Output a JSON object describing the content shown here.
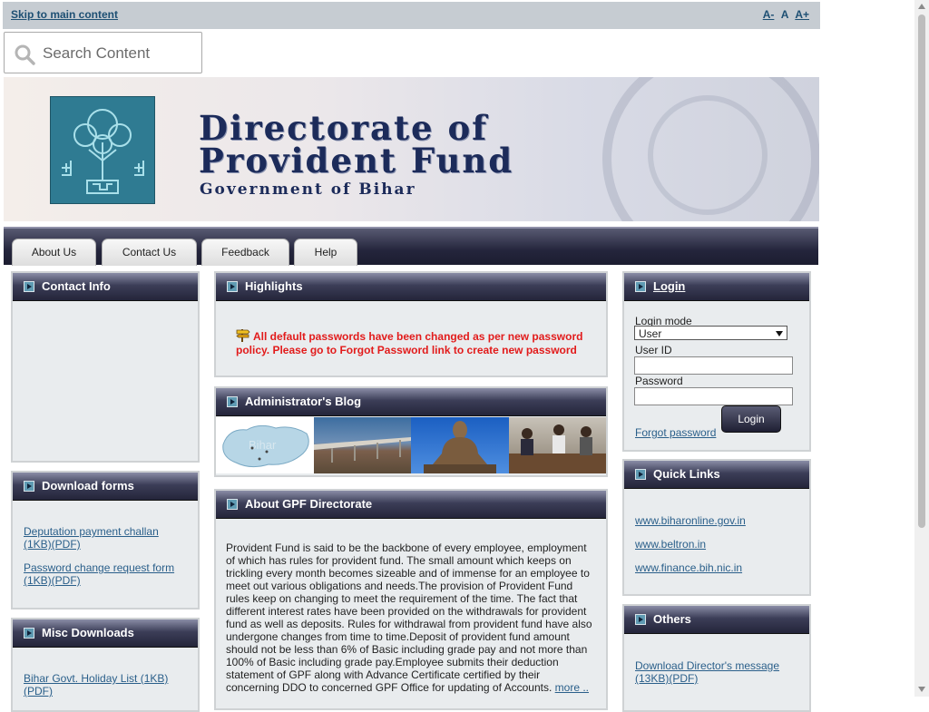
{
  "topbar": {
    "skip_link": "Skip to main content",
    "font_smaller": "A-",
    "font_normal": "A",
    "font_larger": "A+"
  },
  "search": {
    "placeholder": "Search Content"
  },
  "banner": {
    "title_line1": "Directorate of",
    "title_line2": "Provident Fund",
    "subtitle": "Government of Bihar"
  },
  "nav": {
    "tabs": [
      {
        "label": "About Us"
      },
      {
        "label": "Contact Us"
      },
      {
        "label": "Feedback"
      },
      {
        "label": "Help"
      }
    ]
  },
  "contact_info": {
    "title": "Contact Info"
  },
  "download_forms": {
    "title": "Download forms",
    "links": [
      {
        "label": "Deputation payment challan (1KB)(PDF)"
      },
      {
        "label": "Password change request form (1KB)(PDF)"
      }
    ]
  },
  "misc_downloads": {
    "title": "Misc Downloads",
    "links": [
      {
        "label": "Bihar Govt. Holiday List (1KB) (PDF)"
      }
    ]
  },
  "highlights": {
    "title": "Highlights",
    "message": "All default passwords have been changed as per new password policy. Please go to Forgot Password link to create new password"
  },
  "blog": {
    "title": "Administrator's Blog",
    "images": [
      "bihar-map-image",
      "bridge-image",
      "buddha-statue-image",
      "office-meeting-image"
    ],
    "map_label": "Bihar"
  },
  "about": {
    "title": "About GPF Directorate",
    "text": "Provident Fund is said to be the backbone of every employee, employment of which has rules for provident fund. The small amount which keeps on trickling every month becomes sizeable and of immense for an employee to meet out various obligations and needs.The provision of Provident Fund rules keep on changing to meet the requirement of the time. The fact that different interest rates have been provided on the withdrawals for provident fund as well as deposits. Rules for withdrawal from provident fund have also undergone changes from time to time.Deposit of provident fund amount should not be less than 6% of Basic including grade pay and not more than 100% of Basic including grade pay.Employee submits their deduction statement of GPF along with Advance Certificate certified by their concerning DDO to concerned GPF Office for updating of Accounts.",
    "more_link": "more .."
  },
  "login": {
    "title": "Login",
    "mode_label": "Login mode",
    "mode_value": "User",
    "userid_label": "User ID",
    "userid_value": "",
    "password_label": "Password",
    "password_value": "",
    "button": "Login",
    "forgot_link": "Forgot password"
  },
  "quick_links": {
    "title": "Quick Links",
    "links": [
      {
        "label": "www.biharonline.gov.in"
      },
      {
        "label": "www.beltron.in"
      },
      {
        "label": "www.finance.bih.nic.in"
      }
    ]
  },
  "others": {
    "title": "Others",
    "links": [
      {
        "label": "Download Director's message (13KB)(PDF)"
      }
    ]
  },
  "colors": {
    "accent_red": "#e21b1b",
    "link_blue": "#2a5f8a",
    "header_dark": "#24253a"
  }
}
